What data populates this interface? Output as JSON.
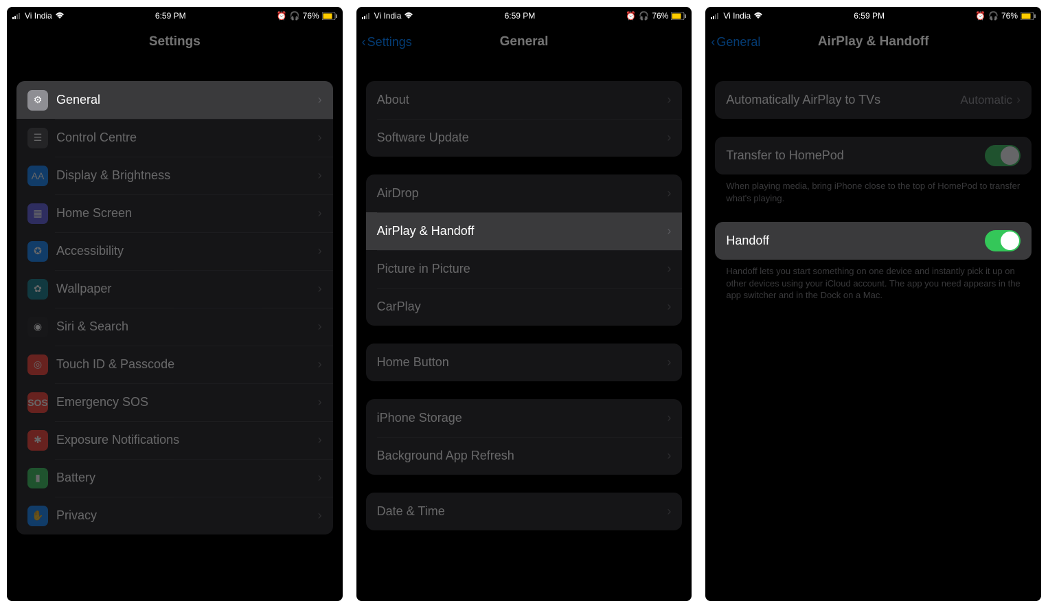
{
  "statusbar": {
    "carrier": "Vi India",
    "time": "6:59 PM",
    "battery_pct": "76%"
  },
  "screen1": {
    "title": "Settings",
    "items": [
      {
        "label": "General",
        "icon": "gear",
        "highlight": true
      },
      {
        "label": "Control Centre",
        "icon": "cc"
      },
      {
        "label": "Display & Brightness",
        "icon": "disp"
      },
      {
        "label": "Home Screen",
        "icon": "home"
      },
      {
        "label": "Accessibility",
        "icon": "access"
      },
      {
        "label": "Wallpaper",
        "icon": "wall"
      },
      {
        "label": "Siri & Search",
        "icon": "siri"
      },
      {
        "label": "Touch ID & Passcode",
        "icon": "touch"
      },
      {
        "label": "Emergency SOS",
        "icon": "sos"
      },
      {
        "label": "Exposure Notifications",
        "icon": "exp"
      },
      {
        "label": "Battery",
        "icon": "batt"
      },
      {
        "label": "Privacy",
        "icon": "priv"
      }
    ]
  },
  "screen2": {
    "back": "Settings",
    "title": "General",
    "group1": [
      {
        "label": "About"
      },
      {
        "label": "Software Update"
      }
    ],
    "group2": [
      {
        "label": "AirDrop"
      },
      {
        "label": "AirPlay & Handoff",
        "highlight": true
      },
      {
        "label": "Picture in Picture"
      },
      {
        "label": "CarPlay"
      }
    ],
    "group3": [
      {
        "label": "Home Button"
      }
    ],
    "group4": [
      {
        "label": "iPhone Storage"
      },
      {
        "label": "Background App Refresh"
      }
    ],
    "group5": [
      {
        "label": "Date & Time"
      }
    ]
  },
  "screen3": {
    "back": "General",
    "title": "AirPlay & Handoff",
    "row1": {
      "label": "Automatically AirPlay to TVs",
      "value": "Automatic"
    },
    "row2": {
      "label": "Transfer to HomePod",
      "toggle": true,
      "on": true
    },
    "footer2": "When playing media, bring iPhone close to the top of HomePod to transfer what's playing.",
    "row3": {
      "label": "Handoff",
      "toggle": true,
      "on": true,
      "highlight": true
    },
    "footer3": "Handoff lets you start something on one device and instantly pick it up on other devices using your iCloud account. The app you need appears in the app switcher and in the Dock on a Mac."
  }
}
